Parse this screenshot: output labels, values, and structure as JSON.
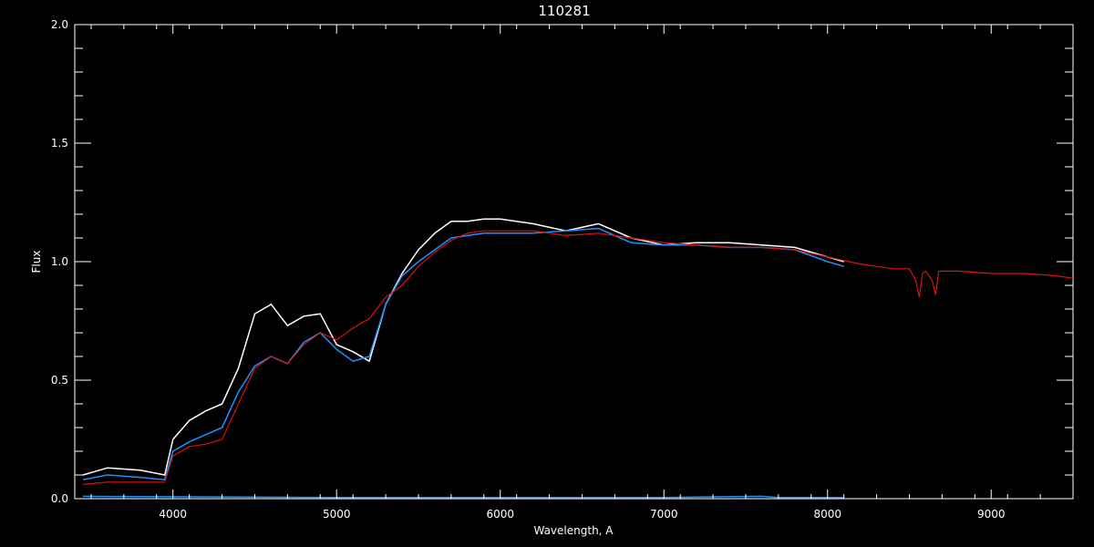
{
  "chart_data": {
    "type": "line",
    "title": "110281",
    "xlabel": "Wavelength, A",
    "ylabel": "Flux",
    "xlim": [
      3400,
      9500
    ],
    "ylim": [
      0.0,
      2.0
    ],
    "x_ticks": [
      4000,
      5000,
      6000,
      7000,
      8000,
      9000
    ],
    "y_ticks": [
      0.0,
      0.5,
      1.0,
      1.5,
      2.0
    ],
    "y_tick_labels": [
      "0.0",
      "0.5",
      "1.0",
      "1.5",
      "2.0"
    ],
    "grid": false,
    "background": "#000000",
    "series": [
      {
        "color": "#ffffff",
        "x": [
          3450,
          3600,
          3800,
          3950,
          4000,
          4100,
          4200,
          4300,
          4400,
          4500,
          4600,
          4700,
          4800,
          4900,
          5000,
          5100,
          5200,
          5300,
          5400,
          5500,
          5600,
          5700,
          5800,
          5900,
          6000,
          6200,
          6400,
          6600,
          6800,
          7000,
          7200,
          7400,
          7600,
          7800,
          8000,
          8100
        ],
        "y": [
          0.1,
          0.13,
          0.12,
          0.1,
          0.25,
          0.33,
          0.37,
          0.4,
          0.55,
          0.78,
          0.82,
          0.73,
          0.77,
          0.78,
          0.65,
          0.62,
          0.58,
          0.82,
          0.95,
          1.05,
          1.12,
          1.17,
          1.17,
          1.18,
          1.18,
          1.16,
          1.13,
          1.16,
          1.1,
          1.07,
          1.08,
          1.08,
          1.07,
          1.06,
          1.02,
          1.0
        ]
      },
      {
        "color": "#1e90ff",
        "x": [
          3450,
          3600,
          3800,
          3950,
          4000,
          4100,
          4200,
          4300,
          4400,
          4500,
          4600,
          4700,
          4800,
          4900,
          5000,
          5100,
          5200,
          5300,
          5400,
          5500,
          5600,
          5700,
          5800,
          5900,
          6000,
          6200,
          6400,
          6600,
          6800,
          7000,
          7200,
          7400,
          7600,
          7800,
          8000,
          8100
        ],
        "y": [
          0.08,
          0.1,
          0.09,
          0.08,
          0.2,
          0.24,
          0.27,
          0.3,
          0.45,
          0.56,
          0.6,
          0.57,
          0.66,
          0.7,
          0.63,
          0.58,
          0.6,
          0.82,
          0.94,
          1.0,
          1.05,
          1.1,
          1.11,
          1.12,
          1.12,
          1.12,
          1.13,
          1.14,
          1.08,
          1.07,
          1.07,
          1.06,
          1.06,
          1.05,
          1.0,
          0.98
        ]
      },
      {
        "color": "#dd1111",
        "x": [
          3450,
          3600,
          3800,
          3950,
          4000,
          4100,
          4200,
          4300,
          4400,
          4500,
          4600,
          4700,
          4800,
          4900,
          5000,
          5100,
          5200,
          5300,
          5400,
          5500,
          5600,
          5700,
          5800,
          5900,
          6000,
          6200,
          6400,
          6600,
          6800,
          7000,
          7200,
          7400,
          7600,
          7800,
          8000,
          8200,
          8400,
          8500,
          8540,
          8560,
          8580,
          8600,
          8640,
          8660,
          8680,
          8700,
          8800,
          9000,
          9200,
          9400,
          9500
        ],
        "y": [
          0.06,
          0.07,
          0.07,
          0.07,
          0.18,
          0.22,
          0.23,
          0.25,
          0.4,
          0.55,
          0.6,
          0.57,
          0.65,
          0.7,
          0.67,
          0.72,
          0.76,
          0.85,
          0.9,
          0.98,
          1.04,
          1.09,
          1.12,
          1.13,
          1.13,
          1.13,
          1.11,
          1.12,
          1.1,
          1.08,
          1.07,
          1.06,
          1.06,
          1.05,
          1.02,
          0.99,
          0.97,
          0.97,
          0.92,
          0.85,
          0.95,
          0.96,
          0.92,
          0.86,
          0.96,
          0.96,
          0.96,
          0.95,
          0.95,
          0.94,
          0.93
        ]
      },
      {
        "color": "#1e90ff",
        "x": [
          3450,
          5000,
          6000,
          7000,
          7600,
          7700,
          8100
        ],
        "y": [
          0.01,
          0.005,
          0.005,
          0.005,
          0.01,
          0.005,
          0.005
        ]
      }
    ]
  }
}
